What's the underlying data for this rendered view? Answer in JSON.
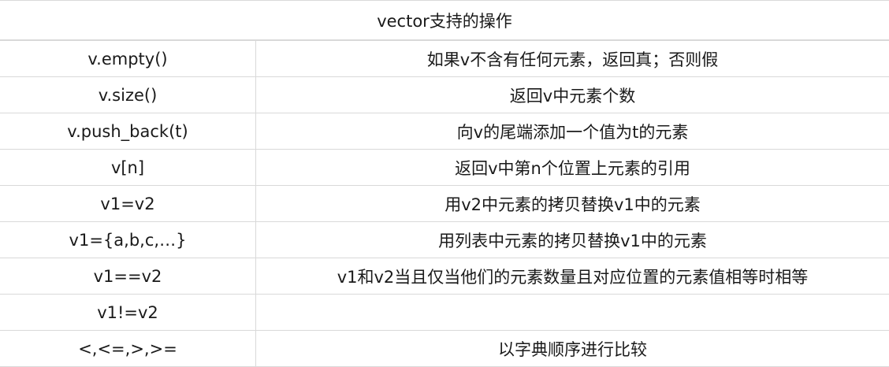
{
  "table": {
    "title": "vector支持的操作",
    "rows": [
      {
        "op": "v.empty()",
        "desc": "如果v不含有任何元素，返回真；否则假"
      },
      {
        "op": "v.size()",
        "desc": "返回v中元素个数"
      },
      {
        "op": "v.push_back(t)",
        "desc": "向v的尾端添加一个值为t的元素"
      },
      {
        "op": "v[n]",
        "desc": "返回v中第n个位置上元素的引用"
      },
      {
        "op": "v1=v2",
        "desc": "用v2中元素的拷贝替换v1中的元素"
      },
      {
        "op": "v1={a,b,c,…}",
        "desc": "用列表中元素的拷贝替换v1中的元素"
      },
      {
        "op": "v1==v2",
        "desc": "v1和v2当且仅当他们的元素数量且对应位置的元素值相等时相等"
      },
      {
        "op": "v1!=v2",
        "desc": ""
      },
      {
        "op": "<,<=,>,>=",
        "desc": "以字典顺序进行比较"
      }
    ]
  }
}
